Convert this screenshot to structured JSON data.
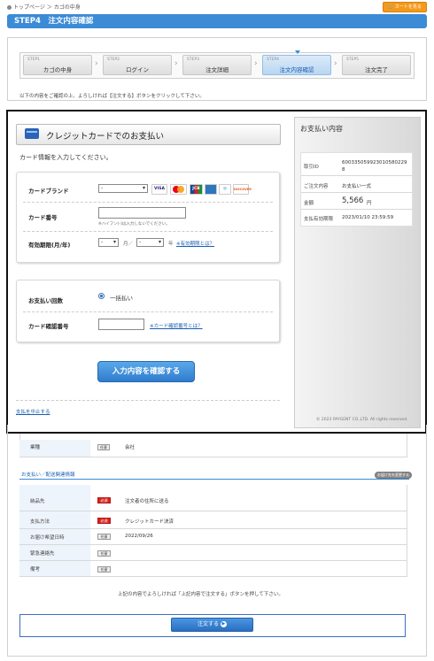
{
  "header": {
    "breadcrumb": "トップページ ＞ カゴの中身",
    "cart_button": "カートを見る",
    "step_title": "STEP4　注文内容確認"
  },
  "steps": [
    {
      "num": "STEP1",
      "label": "カゴの中身"
    },
    {
      "num": "STEP2",
      "label": "ログイン"
    },
    {
      "num": "STEP3",
      "label": "注文詳細"
    },
    {
      "num": "STEP4",
      "label": "注文内容確認"
    },
    {
      "num": "STEP5",
      "label": "注文完了"
    }
  ],
  "instruction": "以下の内容をご確認の上、よろしければ【注文する】ボタンをクリックして下さい。",
  "payment": {
    "title": "クレジットカードでのお支払い",
    "card_info_text": "カード情報を入力してください。",
    "brand_label": "カードブランド",
    "brand_value": "-",
    "card_logos": [
      "VISA",
      "MC",
      "JCB",
      "AMEX",
      "Diners",
      "DISCOVER"
    ],
    "number_label": "カード番号",
    "number_note": "※ハイフン(-)は入力しないでください。",
    "expiry_label": "有効期限(月/年)",
    "expiry_month": "-",
    "expiry_month_unit": "月／",
    "expiry_year": "-",
    "expiry_year_unit": "年",
    "expiry_link": "※有効期限とは？",
    "installment_label": "お支払い回数",
    "installment_value": "一括払い",
    "cvv_label": "カード確認番号",
    "cvv_link": "※カード確認番号とは？",
    "confirm_button": "入力内容を確認する",
    "cancel_link": "支払を中止する"
  },
  "summary": {
    "title": "お支払い内容",
    "rows": [
      {
        "label": "取引ID",
        "value": "600335059923010580229 8"
      },
      {
        "label": "ご注文内容",
        "value": "お支払い一式"
      },
      {
        "label": "金額",
        "value": "5,566",
        "unit": "円"
      },
      {
        "label": "支払有効期限",
        "value": "2023/01/10 23:59:59"
      }
    ],
    "copyright": "© 2023 PAYGENT CO.,LTD. All rights reserved."
  },
  "lower": {
    "top_row": {
      "label": "業種",
      "tag": "任意",
      "value": "会社"
    },
    "section_title": "お支払い／配送関連情報",
    "section_button": "お届け先を変更する",
    "rows": [
      {
        "label": "納品先",
        "tag": "必須",
        "value": "注文者の住所に送る",
        "required": true
      },
      {
        "label": "支払方法",
        "tag": "必須",
        "value": "クレジットカード決済",
        "required": true
      },
      {
        "label": "お届け希望日時",
        "tag": "任意",
        "value": "2022/09/26",
        "required": false
      },
      {
        "label": "緊急連絡先",
        "tag": "任意",
        "value": "",
        "required": false
      },
      {
        "label": "備考",
        "tag": "任意",
        "value": "",
        "required": false
      }
    ],
    "footer_instruction": "上記の内容でよろしければ「上記内容で注文する」ボタンを押して下さい。",
    "order_button": "注文する"
  },
  "colors": {
    "accent": "#3b8bd6",
    "cart": "#f39a1c",
    "required": "#d8221e"
  }
}
